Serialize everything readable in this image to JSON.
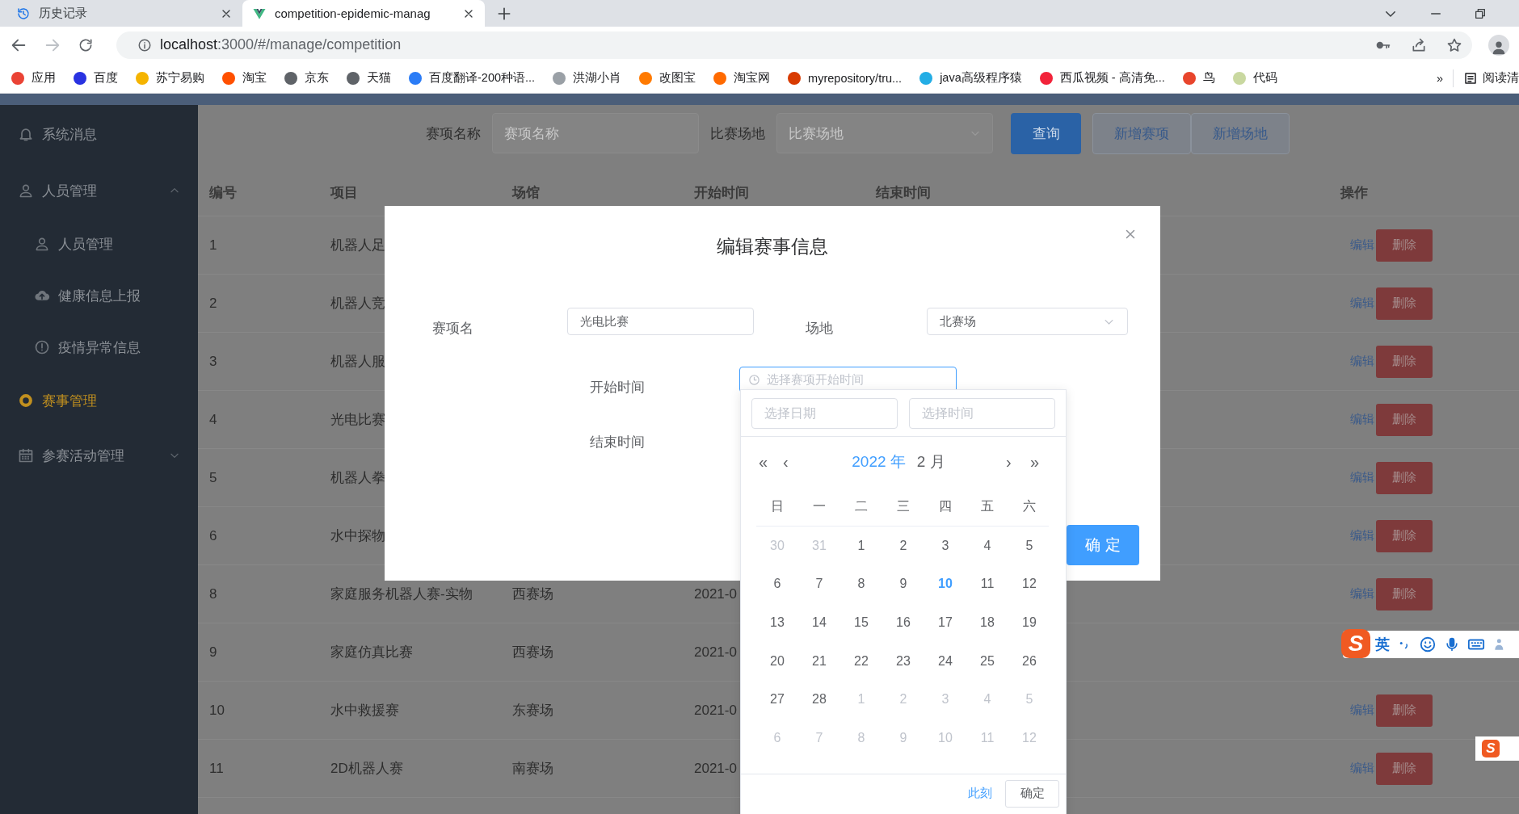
{
  "browser": {
    "tabs": [
      {
        "title": "历史记录",
        "selected": false
      },
      {
        "title": "competition-epidemic-manag",
        "selected": true
      }
    ],
    "url": {
      "host": "localhost",
      "rest": ":3000/#/manage/competition"
    },
    "bookmarks": [
      {
        "label": "应用",
        "color": "#ea4335"
      },
      {
        "label": "百度",
        "color": "#2932e1"
      },
      {
        "label": "苏宁易购",
        "color": "#f5b400"
      },
      {
        "label": "淘宝",
        "color": "#ff5000"
      },
      {
        "label": "京东",
        "color": "#5f6368"
      },
      {
        "label": "天猫",
        "color": "#5f6368"
      },
      {
        "label": "百度翻译-200种语...",
        "color": "#2b7cf6"
      },
      {
        "label": "洪湖小肖",
        "color": "#9aa0a6"
      },
      {
        "label": "改图宝",
        "color": "#ff7a00"
      },
      {
        "label": "淘宝网",
        "color": "#ff6a00"
      },
      {
        "label": "myrepository/tru...",
        "color": "#d83b01"
      },
      {
        "label": "java高级程序猿",
        "color": "#23ade5"
      },
      {
        "label": "西瓜视频 - 高清免...",
        "color": "#f2233a"
      },
      {
        "label": "鸟",
        "color": "#e8452c"
      },
      {
        "label": "代码",
        "color": "#c9d8a0"
      }
    ],
    "overflow": "»",
    "reading_list": "阅读清"
  },
  "sidebar": {
    "items": [
      {
        "label": "系统消息",
        "selected": false
      },
      {
        "label": "人员管理",
        "selected": false,
        "expanded": true,
        "children": [
          {
            "label": "人员管理",
            "selected": false
          },
          {
            "label": "健康信息上报",
            "selected": false
          },
          {
            "label": "疫情异常信息",
            "selected": false
          }
        ]
      },
      {
        "label": "赛事管理",
        "selected": true
      },
      {
        "label": "参赛活动管理",
        "selected": false,
        "expanded": false
      }
    ]
  },
  "search": {
    "name_field": {
      "label": "赛项名称",
      "placeholder": "赛项名称"
    },
    "venue_field": {
      "label": "比赛场地",
      "placeholder": "比赛场地"
    },
    "buttons": [
      {
        "label": "查询",
        "kind": "primary"
      },
      {
        "label": "新增赛项",
        "kind": "plain"
      },
      {
        "label": "新增场地",
        "kind": "plain"
      }
    ]
  },
  "table": {
    "columns": [
      "编号",
      "项目",
      "场馆",
      "开始时间",
      "结束时间",
      "操作"
    ],
    "rows": [
      {
        "id": "1",
        "project": "机器人足",
        "actions": {
          "edit": "编辑",
          "delete": "删除"
        }
      },
      {
        "id": "2",
        "project": "机器人竞",
        "actions": {
          "edit": "编辑",
          "delete": "删除"
        }
      },
      {
        "id": "3",
        "project": "机器人服",
        "actions": {
          "edit": "编辑",
          "delete": "删除"
        }
      },
      {
        "id": "4",
        "project": "光电比赛",
        "actions": {
          "edit": "编辑",
          "delete": "删除"
        }
      },
      {
        "id": "5",
        "project": "机器人拳",
        "actions": {
          "edit": "编辑",
          "delete": "删除"
        }
      },
      {
        "id": "6",
        "project": "水中探物",
        "actions": {
          "edit": "编辑",
          "delete": "删除"
        }
      },
      {
        "id": "8",
        "project": "家庭服务机器人赛-实物",
        "venue": "西赛场",
        "start": "2021-0",
        "actions": {
          "edit": "编辑",
          "delete": "删除"
        }
      },
      {
        "id": "9",
        "project": "家庭仿真比赛",
        "venue": "西赛场",
        "start": "2021-0"
      },
      {
        "id": "10",
        "project": "水中救援赛",
        "venue": "东赛场",
        "start": "2021-0",
        "actions": {
          "edit": "编辑",
          "delete": "删除"
        }
      },
      {
        "id": "11",
        "project": "2D机器人赛",
        "venue": "南赛场",
        "start": "2021-0",
        "actions": {
          "edit": "编辑",
          "delete": "删除"
        }
      }
    ]
  },
  "dialog": {
    "title": "编辑赛事信息",
    "name_field": {
      "label": "赛项名",
      "value": "光电比赛"
    },
    "venue_field": {
      "label": "场地",
      "value": "北赛场"
    },
    "start_field": {
      "label": "开始时间",
      "placeholder": "选择赛项开始时间",
      "focused": true
    },
    "end_field": {
      "label": "结束时间"
    },
    "confirm": "确 定"
  },
  "datepicker": {
    "date_field": {
      "placeholder": "选择日期"
    },
    "time_field": {
      "placeholder": "选择时间"
    },
    "nav": [
      "«",
      "‹",
      "›",
      "»"
    ],
    "year": "2022 年",
    "month": "2 月",
    "weekdays": [
      "日",
      "一",
      "二",
      "三",
      "四",
      "五",
      "六"
    ],
    "weeks": [
      [
        {
          "day": "30",
          "kind": "other"
        },
        {
          "day": "31",
          "kind": "other"
        },
        {
          "day": "1",
          "kind": "current"
        },
        {
          "day": "2",
          "kind": "current"
        },
        {
          "day": "3",
          "kind": "current"
        },
        {
          "day": "4",
          "kind": "current"
        },
        {
          "day": "5",
          "kind": "current"
        }
      ],
      [
        {
          "day": "6",
          "kind": "current"
        },
        {
          "day": "7",
          "kind": "current"
        },
        {
          "day": "8",
          "kind": "current"
        },
        {
          "day": "9",
          "kind": "current"
        },
        {
          "day": "10",
          "kind": "today"
        },
        {
          "day": "11",
          "kind": "current"
        },
        {
          "day": "12",
          "kind": "current"
        }
      ],
      [
        {
          "day": "13",
          "kind": "current"
        },
        {
          "day": "14",
          "kind": "current"
        },
        {
          "day": "15",
          "kind": "current"
        },
        {
          "day": "16",
          "kind": "current"
        },
        {
          "day": "17",
          "kind": "current"
        },
        {
          "day": "18",
          "kind": "current"
        },
        {
          "day": "19",
          "kind": "current"
        }
      ],
      [
        {
          "day": "20",
          "kind": "current"
        },
        {
          "day": "21",
          "kind": "current"
        },
        {
          "day": "22",
          "kind": "current"
        },
        {
          "day": "23",
          "kind": "current"
        },
        {
          "day": "24",
          "kind": "current"
        },
        {
          "day": "25",
          "kind": "current"
        },
        {
          "day": "26",
          "kind": "current"
        }
      ],
      [
        {
          "day": "27",
          "kind": "current"
        },
        {
          "day": "28",
          "kind": "current"
        },
        {
          "day": "1",
          "kind": "other"
        },
        {
          "day": "2",
          "kind": "other"
        },
        {
          "day": "3",
          "kind": "other"
        },
        {
          "day": "4",
          "kind": "other"
        },
        {
          "day": "5",
          "kind": "other"
        }
      ],
      [
        {
          "day": "6",
          "kind": "other"
        },
        {
          "day": "7",
          "kind": "other"
        },
        {
          "day": "8",
          "kind": "other"
        },
        {
          "day": "9",
          "kind": "other"
        },
        {
          "day": "10",
          "kind": "other"
        },
        {
          "day": "11",
          "kind": "other"
        },
        {
          "day": "12",
          "kind": "other"
        }
      ]
    ],
    "now_link": "此刻",
    "confirm": "确定"
  },
  "ime": {
    "logo": "S",
    "mode": "英"
  },
  "ime_mini": {
    "logo": "S"
  }
}
